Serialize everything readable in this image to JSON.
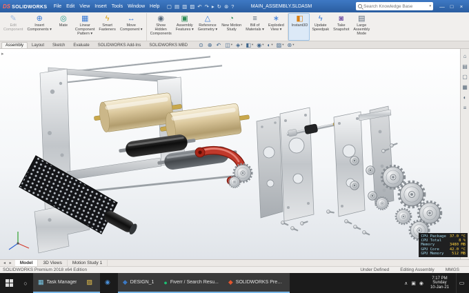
{
  "titlebar": {
    "brand_ds": "DS",
    "brand": "SOLIDWORKS",
    "menus": [
      "File",
      "Edit",
      "View",
      "Insert",
      "Tools",
      "Window",
      "Help"
    ],
    "qat": [
      {
        "glyph": "▢",
        "name": "new-document-icon"
      },
      {
        "glyph": "▤",
        "name": "open-document-icon"
      },
      {
        "glyph": "▥",
        "name": "save-icon"
      },
      {
        "glyph": "▨",
        "name": "print-icon"
      },
      {
        "glyph": "↶",
        "name": "undo-icon"
      },
      {
        "glyph": "↷",
        "name": "redo-icon"
      },
      {
        "glyph": "▸",
        "name": "select-icon"
      },
      {
        "glyph": "↻",
        "name": "rebuild-icon"
      },
      {
        "glyph": "⊛",
        "name": "options-icon"
      },
      {
        "glyph": "?",
        "name": "help-icon"
      }
    ],
    "document_title": "MAIN_ASSEMBLY.SLDASM",
    "search_placeholder": "Search Knowledge Base",
    "search_dd": "▾",
    "win_min": "—",
    "win_max": "□",
    "win_close": "×"
  },
  "ribbon": {
    "buttons": [
      {
        "l1": "Edit",
        "l2": "Component",
        "glyph": "✎",
        "color": "#3a7bd5",
        "icon_name": "edit-component-icon",
        "disabled": true
      },
      {
        "l1": "Insert",
        "l2": "Components ▾",
        "glyph": "⊕",
        "color": "#3a7bd5",
        "icon_name": "insert-components-icon"
      },
      {
        "l1": "Mate",
        "glyph": "◎",
        "color": "#2a9d8f",
        "icon_name": "mate-icon"
      },
      {
        "l1": "Linear",
        "l2": "Component",
        "l3": "Pattern ▾",
        "glyph": "▦",
        "color": "#3a7bd5",
        "icon_name": "linear-component-pattern-icon"
      },
      {
        "l1": "Smart",
        "l2": "Fasteners",
        "glyph": "ϟ",
        "color": "#d9a012",
        "icon_name": "smart-fasteners-icon"
      },
      {
        "l1": "Move",
        "l2": "Component ▾",
        "glyph": "↔",
        "color": "#3a7bd5",
        "icon_name": "move-component-icon"
      },
      {
        "l1": "Show",
        "l2": "Hidden",
        "l3": "Components",
        "glyph": "◉",
        "color": "#5a6b7c",
        "icon_name": "show-hidden-components-icon",
        "sep": true
      },
      {
        "l1": "Assembly",
        "l2": "Features ▾",
        "glyph": "▣",
        "color": "#2e8b57",
        "icon_name": "assembly-features-icon"
      },
      {
        "l1": "Reference",
        "l2": "Geometry ▾",
        "glyph": "△",
        "color": "#3a7bd5",
        "icon_name": "reference-geometry-icon"
      },
      {
        "l1": "New Motion",
        "l2": "Study",
        "glyph": "◔",
        "color": "#2e8b57",
        "icon_name": "new-motion-study-icon"
      },
      {
        "l1": "Bill of",
        "l2": "Materials ▾",
        "glyph": "≡",
        "color": "#5a6b7c",
        "icon_name": "bill-of-materials-icon"
      },
      {
        "l1": "Exploded",
        "l2": "View ▾",
        "glyph": "∗",
        "color": "#3a7bd5",
        "icon_name": "exploded-view-icon"
      },
      {
        "l1": "Instant3D",
        "glyph": "◧",
        "color": "#d97f12",
        "icon_name": "instant3d-icon",
        "sep": true,
        "active": true
      },
      {
        "l1": "Update",
        "l2": "Speedpak",
        "glyph": "ϟ",
        "color": "#3a7bd5",
        "icon_name": "update-speedpak-icon"
      },
      {
        "l1": "Take",
        "l2": "Snapshot",
        "glyph": "◙",
        "color": "#7a5ca8",
        "icon_name": "take-snapshot-icon"
      },
      {
        "l1": "Large",
        "l2": "Assembly",
        "l3": "Mode",
        "glyph": "▤",
        "color": "#5a6b7c",
        "icon_name": "large-assembly-mode-icon"
      }
    ]
  },
  "cm_tabs": [
    {
      "label": "Assembly",
      "active": true
    },
    {
      "label": "Layout"
    },
    {
      "label": "Sketch"
    },
    {
      "label": "Evaluate"
    },
    {
      "label": "SOLIDWORKS Add-Ins"
    },
    {
      "label": "SOLIDWORKS MBD"
    }
  ],
  "headsup": [
    {
      "glyph": "⊙",
      "name": "zoom-to-fit-icon"
    },
    {
      "glyph": "⊕",
      "name": "zoom-to-area-icon"
    },
    {
      "glyph": "↶",
      "name": "previous-view-icon"
    },
    {
      "glyph": "◫",
      "name": "section-view-icon",
      "dd": "▾"
    },
    {
      "glyph": "◈",
      "name": "view-orientation-icon",
      "dd": "▾"
    },
    {
      "glyph": "◧",
      "name": "display-style-icon",
      "dd": "▾"
    },
    {
      "glyph": "◉",
      "name": "hide-show-items-icon",
      "dd": "▾"
    },
    {
      "glyph": "◐",
      "name": "edit-appearance-icon",
      "dd": "▾"
    },
    {
      "glyph": "▨",
      "name": "apply-scene-icon",
      "dd": "▾"
    },
    {
      "glyph": "⊛",
      "name": "view-settings-icon",
      "dd": "▾"
    }
  ],
  "viewport": {
    "fm_arrow": "▸"
  },
  "taskpane": [
    {
      "glyph": "⌂",
      "name": "solidworks-resources-icon"
    },
    {
      "glyph": "▤",
      "name": "design-library-icon"
    },
    {
      "glyph": "▢",
      "name": "file-explorer-icon"
    },
    {
      "glyph": "▦",
      "name": "view-palette-icon"
    },
    {
      "glyph": "◐",
      "name": "appearances-icon"
    },
    {
      "glyph": "≡",
      "name": "custom-properties-icon"
    }
  ],
  "perf": {
    "rows": [
      {
        "label": "CPU Package",
        "value": "37.0 °C"
      },
      {
        "label": "CPU Total",
        "value": "8 %"
      },
      {
        "label": "Memory",
        "value": "3480 MB"
      },
      {
        "label": "GPU Core",
        "value": "42.0 °C"
      },
      {
        "label": "GPU Memory",
        "value": "512 MB"
      }
    ]
  },
  "vtabs": {
    "arrows": "◂ ▸",
    "items": [
      {
        "label": "Model",
        "active": true
      },
      {
        "label": "3D Views"
      },
      {
        "label": "Motion Study 1"
      }
    ]
  },
  "statusbar": {
    "left": "SOLIDWORKS Premium 2018 x64 Edition",
    "right": [
      "Under Defined",
      "Editing Assembly",
      "MMGS"
    ]
  },
  "taskbar": {
    "search_glyph": "○",
    "apps": [
      {
        "glyph": "▦",
        "color": "#7ac9e8",
        "label": "Task Manager",
        "active": true,
        "icon_name": "task-manager-icon"
      },
      {
        "glyph": "▨",
        "color": "#f2c94c",
        "label": "",
        "active": true,
        "icon_name": "file-explorer-taskbar-icon"
      },
      {
        "glyph": "◉",
        "color": "#4a90d9",
        "label": "",
        "icon_name": "pinned-app-icon"
      },
      {
        "glyph": "◆",
        "color": "#3b78c3",
        "label": "DESIGN_1",
        "active": true,
        "icon_name": "design-app-icon"
      },
      {
        "glyph": "●",
        "color": "#1dbf73",
        "label": "Fiverr / Search Resu...",
        "active": true,
        "icon_name": "fiverr-browser-icon"
      },
      {
        "glyph": "◆",
        "color": "#e2552e",
        "label": "SOLIDWORKS Prem...",
        "active": true,
        "icon_name": "solidworks-app-icon"
      }
    ],
    "tray": {
      "chevron": "∧",
      "icon1": "▣",
      "icon2": "◉",
      "time": "7:17 PM",
      "day": "Sunday",
      "date": "10-Jan-21",
      "action": "▭"
    }
  }
}
